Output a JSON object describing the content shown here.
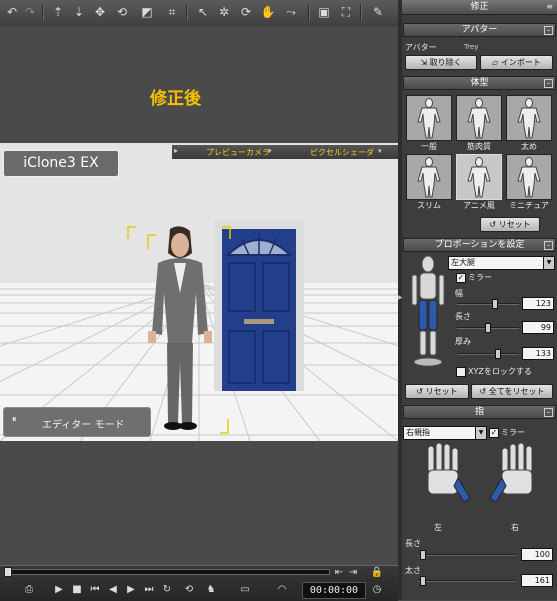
{
  "toolbar": {
    "icons": [
      "undo-icon",
      "redo-icon",
      "move-up-icon",
      "move-down-icon",
      "move-icon",
      "rotate-icon",
      "scale-icon",
      "frame-icon",
      "select-icon",
      "transform-icon",
      "rotate-view-icon",
      "camera-pan-icon",
      "motion-path-icon",
      "screen-icon",
      "fullscreen-icon",
      "pen-icon"
    ]
  },
  "banner": {
    "title": "修正後"
  },
  "viewport": {
    "brand": "iClone3 EX",
    "camera_menu": "プレビューカメラ",
    "shader_menu": "ピクセルシェーダ",
    "editor_mode": "エディター モード",
    "pause_glyph": "⏸"
  },
  "timeline": {
    "time": "00:00:00"
  },
  "panel": {
    "title": "修正",
    "avatar": {
      "header": "アバター",
      "label": "アバター",
      "name": "Trey",
      "remove_button": "取り除く",
      "import_button": "インポート"
    },
    "body_type": {
      "header": "体型",
      "thumbs": [
        {
          "label": "一般"
        },
        {
          "label": "筋肉質"
        },
        {
          "label": "太め"
        },
        {
          "label": "スリム"
        },
        {
          "label": "アニメ風"
        },
        {
          "label": "ミニチュア"
        }
      ],
      "reset_button": "リセット"
    },
    "proportion": {
      "header": "プロポーションを設定",
      "part": "左大腿",
      "mirror": "ミラー",
      "width_label": "幅",
      "width_value": "123",
      "width_fraction": 0.62,
      "length_label": "長さ",
      "length_value": "99",
      "length_fraction": 0.5,
      "thickness_label": "厚み",
      "thickness_value": "133",
      "thickness_fraction": 0.66,
      "lock_xyz": "XYZをロックする",
      "reset_button": "リセット",
      "reset_all_button": "全てをリセット"
    },
    "finger": {
      "header": "指",
      "finger_select": "右親指",
      "mirror": "ミラー",
      "left_label": "左",
      "right_label": "右",
      "length_label": "長さ",
      "length_value": "100",
      "length_fraction": 0.05,
      "thick_label": "太さ",
      "thick_value": "161",
      "thick_fraction": 0.05
    }
  }
}
